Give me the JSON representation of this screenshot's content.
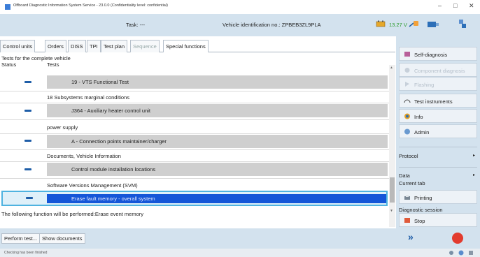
{
  "window": {
    "title": "Offboard Diagnostic Information System Service - 23.0.0 (Confidentiality level: confidential)",
    "minimize": "–",
    "maximize": "□",
    "close": "✕"
  },
  "header": {
    "task": "Task:  ---",
    "vin": "Vehicle identification no.:  ZPBEB3ZL9PLA",
    "voltage": "13.27 V"
  },
  "tabs": [
    {
      "label": "Control units"
    },
    {
      "label": "Orders"
    },
    {
      "label": "DISS"
    },
    {
      "label": "TPI"
    },
    {
      "label": "Test plan"
    },
    {
      "label": "Sequence"
    },
    {
      "label": "Special functions"
    }
  ],
  "section_label": "Tests for the complete vehicle",
  "columns": {
    "status": "Status",
    "tests": "Tests"
  },
  "rows": [
    {
      "label": "19 - VTS Functional Test"
    },
    {
      "label": "18 Subsystems marginal conditions"
    },
    {
      "label": "J364 - Auxiliary heater control unit"
    },
    {
      "label": "power supply"
    },
    {
      "label": "A - Connection points maintainer/charger"
    },
    {
      "label": "Documents, Vehicle Information"
    },
    {
      "label": "Control module installation locations"
    },
    {
      "label": "Software Versions Management (SVM)"
    },
    {
      "label": "Erase fault memory - overall system"
    }
  ],
  "message": "The following function will be performed:Erase event memory",
  "bottom_buttons": {
    "perform": "Perform test...",
    "show_docs": "Show documents"
  },
  "status_bar": "Checking has been finished",
  "right_panel": {
    "self_diagnosis": "Self-diagnosis",
    "component_diagnosis": "Component diagnosis",
    "flashing": "Flashing",
    "test_instruments": "Test instruments",
    "info": "Info",
    "admin": "Admin",
    "protocol": "Protocol",
    "data": "Data",
    "current_tab": "Current tab",
    "printing": "Printing",
    "diagnostic_session": "Diagnostic session",
    "stop": "Stop",
    "next": "»"
  },
  "colors": {
    "header_bg": "#d3e2ee",
    "selected_row": "#1556d8",
    "status_dash": "#1f5ea8",
    "voltage": "#2a9a2a"
  }
}
